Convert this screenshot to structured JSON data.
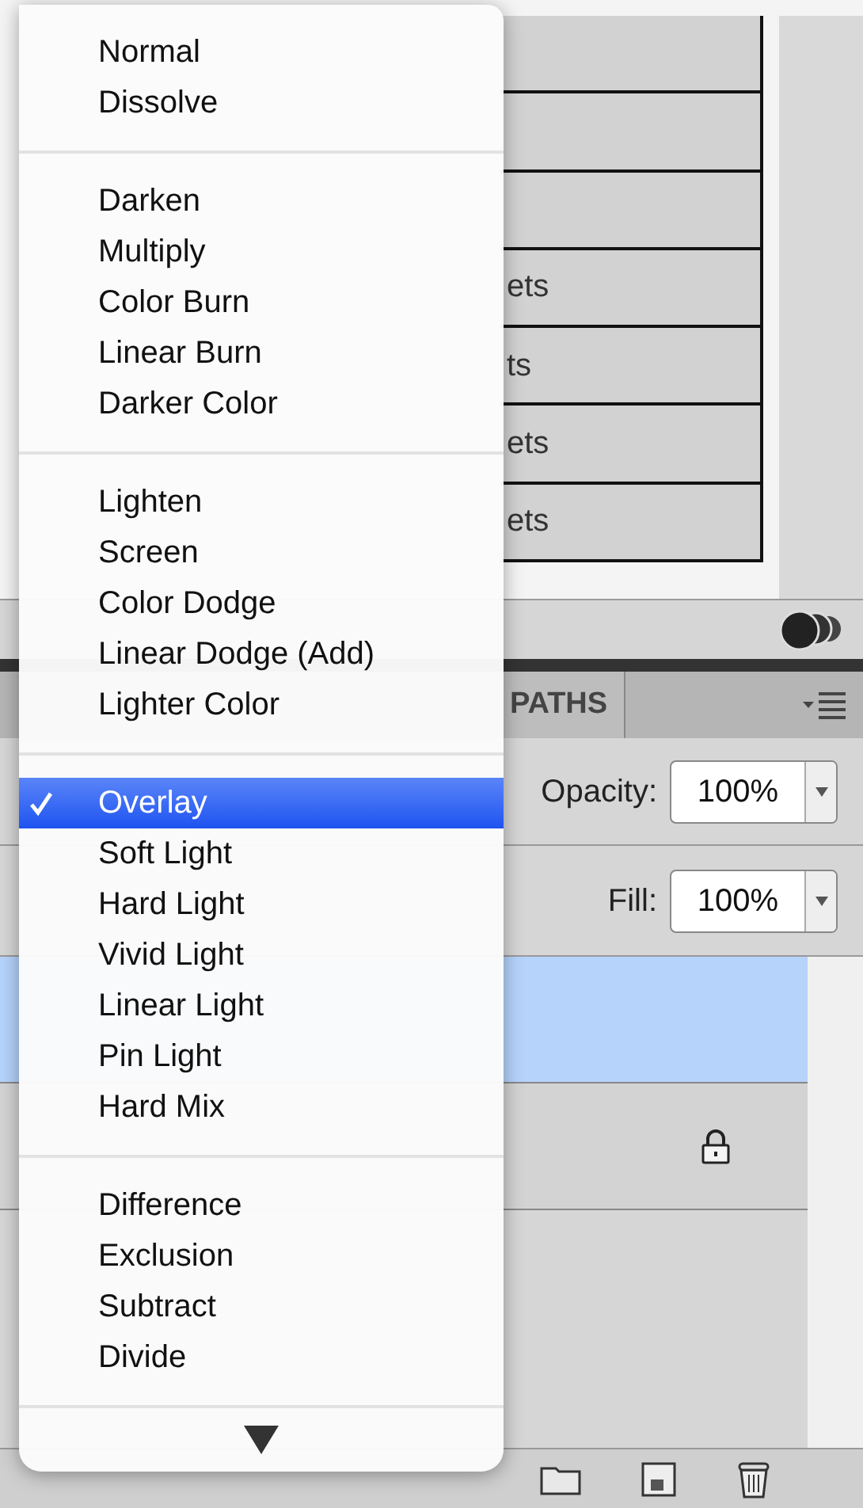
{
  "preset_list": {
    "rows": [
      {
        "text": "ets"
      },
      {
        "text": "ts"
      },
      {
        "text": "ets"
      },
      {
        "text": "ets"
      }
    ]
  },
  "panel_tabs": [
    {
      "label": "PATHS",
      "selected": false
    }
  ],
  "opacity": {
    "label": "Opacity:",
    "value": "100%"
  },
  "fill": {
    "label": "Fill:",
    "value": "100%"
  },
  "layers": [
    {
      "selected": true,
      "locked": false
    },
    {
      "selected": false,
      "locked": true
    }
  ],
  "blend_menu": {
    "groups": [
      {
        "items": [
          {
            "label": "Normal",
            "selected": false
          },
          {
            "label": "Dissolve",
            "selected": false
          }
        ]
      },
      {
        "items": [
          {
            "label": "Darken",
            "selected": false
          },
          {
            "label": "Multiply",
            "selected": false
          },
          {
            "label": "Color Burn",
            "selected": false
          },
          {
            "label": "Linear Burn",
            "selected": false
          },
          {
            "label": "Darker Color",
            "selected": false
          }
        ]
      },
      {
        "items": [
          {
            "label": "Lighten",
            "selected": false
          },
          {
            "label": "Screen",
            "selected": false
          },
          {
            "label": "Color Dodge",
            "selected": false
          },
          {
            "label": "Linear Dodge (Add)",
            "selected": false
          },
          {
            "label": "Lighter Color",
            "selected": false
          }
        ]
      },
      {
        "items": [
          {
            "label": "Overlay",
            "selected": true
          },
          {
            "label": "Soft Light",
            "selected": false
          },
          {
            "label": "Hard Light",
            "selected": false
          },
          {
            "label": "Vivid Light",
            "selected": false
          },
          {
            "label": "Linear Light",
            "selected": false
          },
          {
            "label": "Pin Light",
            "selected": false
          },
          {
            "label": "Hard Mix",
            "selected": false
          }
        ]
      },
      {
        "items": [
          {
            "label": "Difference",
            "selected": false
          },
          {
            "label": "Exclusion",
            "selected": false
          },
          {
            "label": "Subtract",
            "selected": false
          },
          {
            "label": "Divide",
            "selected": false
          }
        ]
      }
    ]
  }
}
